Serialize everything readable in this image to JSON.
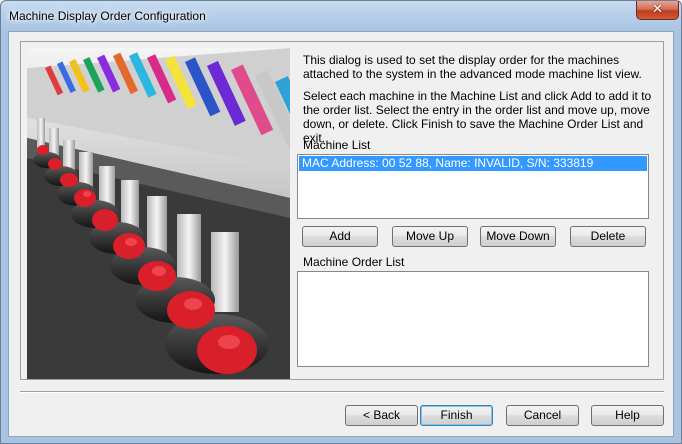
{
  "window": {
    "title": "Machine Display Order Configuration",
    "close_glyph": "✕"
  },
  "description": {
    "paragraph1": "This dialog is used to set the display order for the machines attached to the system in the advanced mode machine list view.",
    "paragraph2": "Select each machine in the Machine List and click Add to add it to the order list. Select the entry in the order list and move up, move down, or delete. Click Finish to save the Machine Order List and exit."
  },
  "machine_list": {
    "label": "Machine List",
    "items": [
      "MAC Address: 00 52 88, Name: INVALID, S/N: 333819"
    ]
  },
  "list_actions": {
    "add": "Add",
    "move_up": "Move Up",
    "move_down": "Move Down",
    "delete": "Delete"
  },
  "order_list": {
    "label": "Machine Order List",
    "items": []
  },
  "footer": {
    "back": "< Back",
    "finish": "Finish",
    "cancel": "Cancel",
    "help": "Help"
  },
  "colors": {
    "selection": "#3399ff",
    "title_bar": "#b7cfe9",
    "close_button": "#c13e1f",
    "cap_red": "#d91f2a"
  },
  "icons": {
    "close": "close-icon"
  }
}
